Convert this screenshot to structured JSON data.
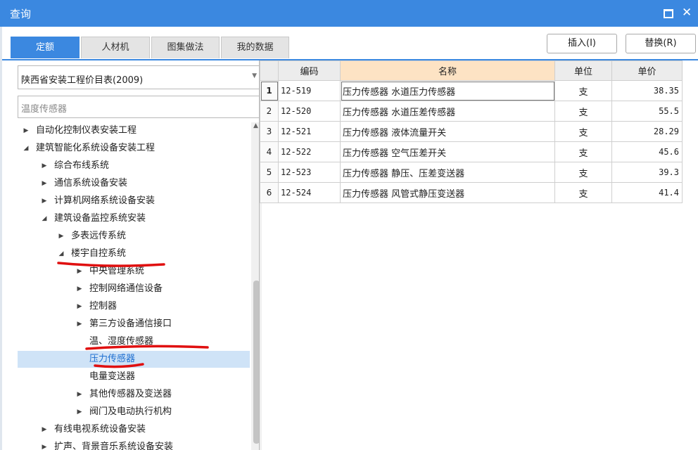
{
  "window": {
    "title": "查询",
    "maximize_glyph": "square-icon",
    "close_glyph": "✕"
  },
  "tabs": [
    {
      "label": "定额",
      "active": true
    },
    {
      "label": "人材机",
      "active": false
    },
    {
      "label": "图集做法",
      "active": false
    },
    {
      "label": "我的数据",
      "active": false
    }
  ],
  "actions": {
    "insert_label": "插入(I)",
    "replace_label": "替换(R)"
  },
  "left": {
    "combo_value": "陕西省安装工程价目表(2009)",
    "search_value": "温度传感器",
    "tree": [
      {
        "label": "自动化控制仪表安装工程",
        "level": 0,
        "state": "collapsed",
        "selected": false
      },
      {
        "label": "建筑智能化系统设备安装工程",
        "level": 0,
        "state": "expanded",
        "selected": false
      },
      {
        "label": "综合布线系统",
        "level": 1,
        "state": "collapsed",
        "selected": false
      },
      {
        "label": "通信系统设备安装",
        "level": 1,
        "state": "collapsed",
        "selected": false
      },
      {
        "label": "计算机网络系统设备安装",
        "level": 1,
        "state": "collapsed",
        "selected": false
      },
      {
        "label": "建筑设备监控系统安装",
        "level": 1,
        "state": "expanded",
        "selected": false
      },
      {
        "label": "多表远传系统",
        "level": 2,
        "state": "collapsed",
        "selected": false
      },
      {
        "label": "楼宇自控系统",
        "level": 2,
        "state": "expanded",
        "selected": false
      },
      {
        "label": "中央管理系统",
        "level": 3,
        "state": "collapsed",
        "selected": false
      },
      {
        "label": "控制网络通信设备",
        "level": 3,
        "state": "collapsed",
        "selected": false
      },
      {
        "label": "控制器",
        "level": 3,
        "state": "collapsed",
        "selected": false
      },
      {
        "label": "第三方设备通信接口",
        "level": 3,
        "state": "collapsed",
        "selected": false
      },
      {
        "label": "温、湿度传感器",
        "level": 3,
        "state": "leaf",
        "selected": false
      },
      {
        "label": "压力传感器",
        "level": 3,
        "state": "leaf",
        "selected": true
      },
      {
        "label": "电量变送器",
        "level": 3,
        "state": "leaf",
        "selected": false
      },
      {
        "label": "其他传感器及变送器",
        "level": 3,
        "state": "collapsed",
        "selected": false
      },
      {
        "label": "阀门及电动执行机构",
        "level": 3,
        "state": "collapsed",
        "selected": false
      },
      {
        "label": "有线电视系统设备安装",
        "level": 1,
        "state": "collapsed",
        "selected": false
      },
      {
        "label": "扩声、背景音乐系统设备安装",
        "level": 1,
        "state": "collapsed",
        "selected": false
      }
    ]
  },
  "table": {
    "columns": [
      "编码",
      "名称",
      "单位",
      "单价"
    ],
    "rows": [
      {
        "no": "1",
        "code": "12-519",
        "name": "压力传感器 水道压力传感器",
        "unit": "支",
        "price": "38.35"
      },
      {
        "no": "2",
        "code": "12-520",
        "name": "压力传感器 水道压差传感器",
        "unit": "支",
        "price": "55.5"
      },
      {
        "no": "3",
        "code": "12-521",
        "name": "压力传感器 液体流量开关",
        "unit": "支",
        "price": "28.29"
      },
      {
        "no": "4",
        "code": "12-522",
        "name": "压力传感器 空气压差开关",
        "unit": "支",
        "price": "45.6"
      },
      {
        "no": "5",
        "code": "12-523",
        "name": "压力传感器 静压、压差变送器",
        "unit": "支",
        "price": "39.3"
      },
      {
        "no": "6",
        "code": "12-524",
        "name": "压力传感器 风管式静压变送器",
        "unit": "支",
        "price": "41.4"
      }
    ]
  },
  "colors": {
    "accent": "#3b88e0",
    "selection": "#cfe3f7",
    "annotation": "#e01010",
    "name_header": "#fde3c4"
  }
}
